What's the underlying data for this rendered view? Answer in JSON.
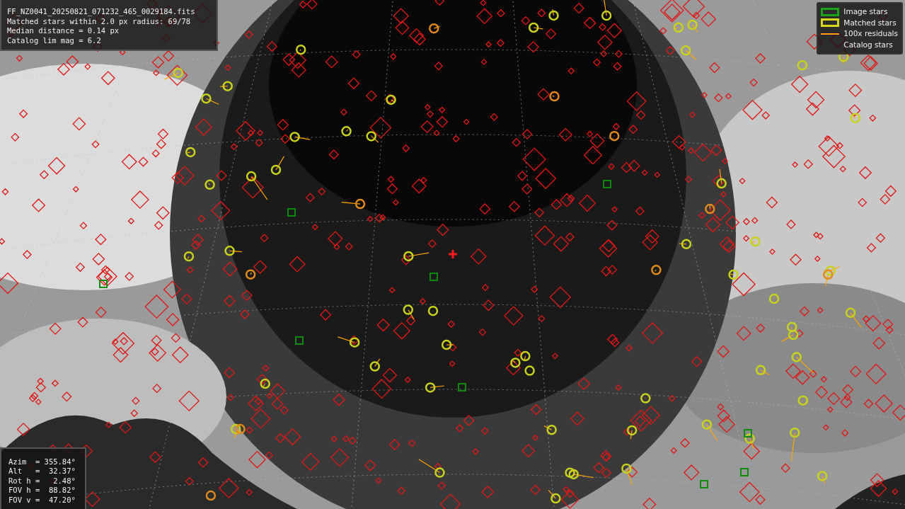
{
  "info_box": {
    "lines": [
      "FF_NZ0041_20250821_071232_465_0029184.fits",
      "Matched stars within 2.0 px radius: 69/78",
      "Median distance = 0.14 px",
      "Catalog lim mag = 6.2"
    ]
  },
  "legend": [
    {
      "label": "Image stars",
      "kind": "box",
      "color": "#1aa31a"
    },
    {
      "label": "Matched stars",
      "kind": "box",
      "color": "#d8d81a"
    },
    {
      "label": "100x residuals",
      "kind": "line",
      "color": "#ff9a1a"
    },
    {
      "label": "Catalog stars",
      "kind": "none"
    }
  ],
  "pointing_box": {
    "lines": [
      "Azim  = 355.84°",
      "Alt   =  32.37°",
      "Rot h =   2.48°",
      "FOV h =  88.82°",
      "FOV v =  47.20°"
    ]
  }
}
